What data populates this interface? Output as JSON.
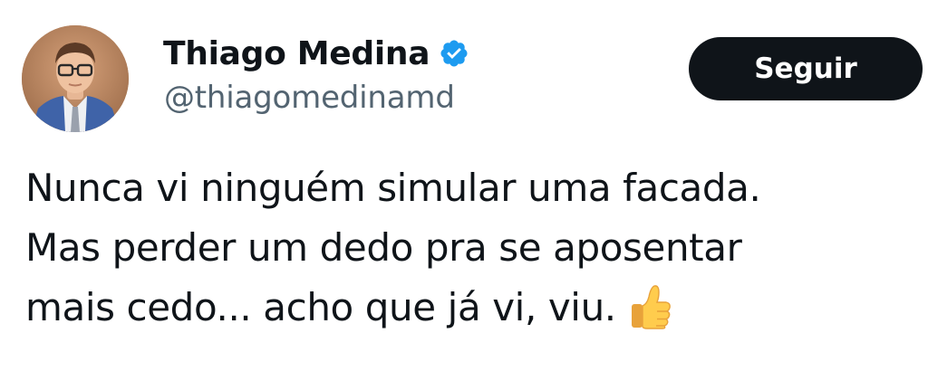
{
  "author": {
    "display_name": "Thiago Medina",
    "handle": "@thiagomedinamd",
    "verified_icon": "verified-badge-icon",
    "avatar": "profile-photo"
  },
  "follow_button": {
    "label": "Seguir"
  },
  "tweet": {
    "lines": [
      "Nunca vi ninguém simular uma facada.",
      "Mas perder um dedo pra se aposentar",
      "mais cedo... acho que já vi, viu."
    ],
    "emoji": "thumbs-up-emoji"
  },
  "colors": {
    "text": "#0f1419",
    "handle": "#536471",
    "verified": "#1d9bf0",
    "button_bg": "#0f1419",
    "button_text": "#ffffff"
  }
}
